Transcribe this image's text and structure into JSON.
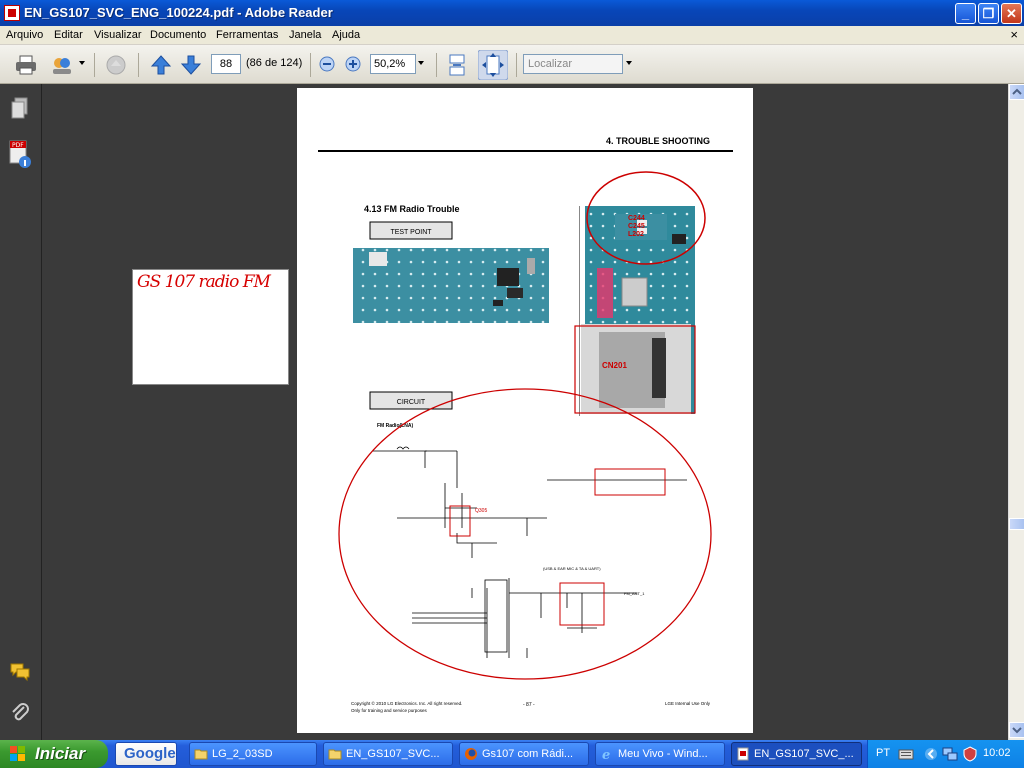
{
  "window": {
    "title": "EN_GS107_SVC_ENG_100224.pdf - Adobe Reader",
    "minimize": "_",
    "restore": "❐",
    "close": "✕"
  },
  "menu": {
    "items": [
      "Arquivo",
      "Editar",
      "Visualizar",
      "Documento",
      "Ferramentas",
      "Janela",
      "Ajuda"
    ],
    "close_doc": "×"
  },
  "toolbar": {
    "page_number": "88",
    "page_count": "(86 de 124)",
    "zoom": "50,2%",
    "search_placeholder": "Localizar"
  },
  "pdf_page": {
    "header": "4. TROUBLE SHOOTING",
    "section_title": "4.13 FM Radio Trouble",
    "test_point_label": "TEST POINT",
    "circuit_label": "CIRCUIT",
    "schematic_title": "FM Radio(LNA)",
    "component_labels": [
      "C244",
      "C245",
      "L202"
    ],
    "connector_label": "CN201",
    "q305_label": "Q305",
    "usb_note": "(USB & EAR MIC & TA & UART)",
    "fm_ant_label": "FM_ANT_1",
    "footer_copyright": "Copyright © 2010 LG Electronics. Inc. All right reserved.",
    "footer_training": "Only for training and service purposes",
    "footer_page": "- 87 -",
    "footer_internal": "LGE Internal Use Only"
  },
  "note": {
    "text": "GS 107 radio FM"
  },
  "taskbar": {
    "start_label": "Iniciar",
    "google_label": "Google",
    "tasks": [
      {
        "label": "LG_2_03SD",
        "icon": "folder-icon"
      },
      {
        "label": "EN_GS107_SVC...",
        "icon": "folder-icon"
      },
      {
        "label": "Gs107 com Rádi...",
        "icon": "firefox-icon"
      },
      {
        "label": "Meu Vivo - Wind...",
        "icon": "ie-icon"
      },
      {
        "label": "EN_GS107_SVC_...",
        "icon": "pdf-icon"
      }
    ],
    "lang": "PT",
    "clock": "10:02"
  },
  "colors": {
    "accent_red": "#cc0000",
    "pcb_teal": "#2f8a9c",
    "xp_blue": "#245edb"
  }
}
